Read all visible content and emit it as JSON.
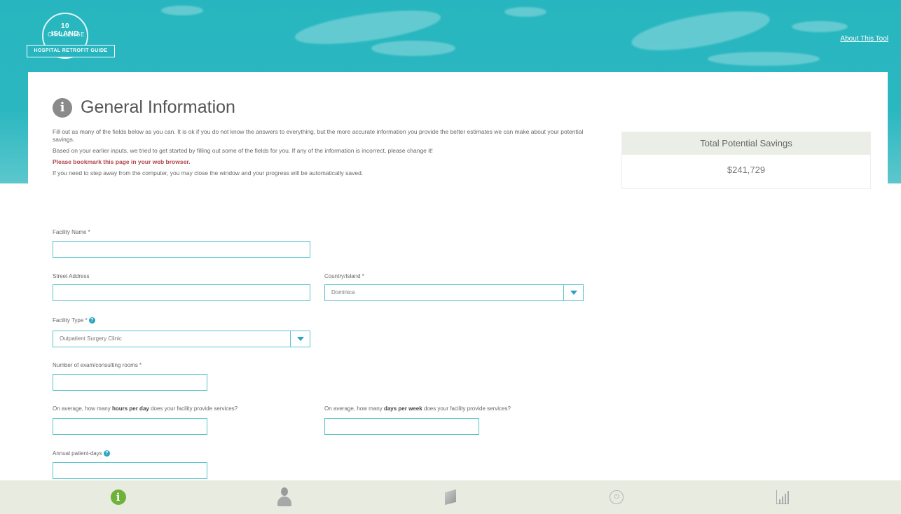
{
  "header": {
    "logo_line1": "10 ISLAND",
    "logo_line2": "CHALLENGE",
    "logo_tag": "HOSPITAL RETROFIT GUIDE",
    "about_link": "About This Tool"
  },
  "page": {
    "title": "General Information",
    "intro": [
      "Fill out as many of the fields below as you can. It is ok if you do not know the answers to everything, but the more accurate information you provide the better estimates we can make about your potential savings.",
      "Based on your earlier inputs, we tried to get started by filling out some of the fields for you. If any of the information is incorrect, please change it!",
      "Please bookmark this page in your web browser.",
      "If you need to step away from the computer, you may close the window and your progress will be automatically saved."
    ]
  },
  "savings": {
    "label": "Total Potential Savings",
    "value": "$241,729"
  },
  "form": {
    "facility_name_label": "Facility Name *",
    "facility_name_value": "",
    "street_address_label": "Street Address",
    "street_address_value": "",
    "country_label": "Country/Island *",
    "country_value": "Dominica",
    "facility_type_label": "Facility Type *",
    "facility_type_value": "Outpatient Surgery Clinic",
    "rooms_label": "Number of exam/consulting rooms *",
    "rooms_value": "",
    "hours_label_pre": "On average, how many ",
    "hours_label_bold": "hours per day",
    "hours_label_post": " does your facility provide services?",
    "hours_value": "",
    "days_label_pre": "On average, how many ",
    "days_label_bold": "days per week",
    "days_label_post": " does your facility provide services?",
    "days_value": "",
    "patient_days_label": "Annual patient-days",
    "patient_days_value": ""
  },
  "nav": {
    "items": [
      "info-icon",
      "person-icon",
      "building-icon",
      "outlet-icon",
      "bar-chart-icon"
    ],
    "active": "info-icon",
    "active_color": "#6fb23a"
  },
  "colors": {
    "banner": "#2bb7c0",
    "accent": "#27a5bf",
    "warn": "#b0464d"
  }
}
